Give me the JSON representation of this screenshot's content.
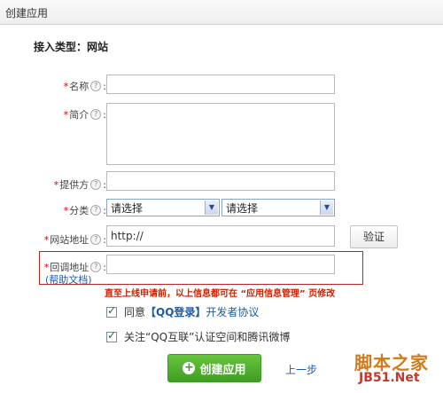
{
  "window": {
    "title": "创建应用"
  },
  "form": {
    "access_type": "接入类型：网站",
    "fields": {
      "name": {
        "label": "名称",
        "required": "*",
        "help": "?",
        "colon": ":",
        "value": ""
      },
      "intro": {
        "label": "简介",
        "required": "*",
        "help": "?",
        "colon": ":",
        "value": ""
      },
      "provider": {
        "label": "提供方",
        "required": "*",
        "help": "?",
        "colon": ":",
        "value": ""
      },
      "category": {
        "label": "分类",
        "required": "*",
        "help": "?",
        "colon": ":",
        "select1": "请选择",
        "select2": "请选择"
      },
      "site_url": {
        "label": "网站地址",
        "required": "*",
        "help": "?",
        "colon": ":",
        "value": "http://"
      },
      "callback_url": {
        "label": "回调地址",
        "required": "*",
        "help": "?",
        "colon": ":",
        "value": ""
      }
    },
    "verify_button": "验证",
    "help_doc": "(帮助文档)",
    "warning": "直至上线申请前，以上信息都可在 “应用信息管理” 页修改",
    "agree": {
      "prefix": "同意",
      "qq_login": "【QQ登录】",
      "agreement": "开发者协议"
    },
    "follow": "关注“QQ互联”认证空间和腾讯微博",
    "create_button": "创建应用",
    "create_icon": "plus-circle-icon",
    "prev_link": "上一步"
  },
  "watermark": {
    "line1": "脚本之家",
    "line2": "JB51.Net"
  },
  "colors": {
    "accent_green": "#4aab2a",
    "link_blue": "#1d5aa8",
    "warning_red": "#cc2200"
  }
}
